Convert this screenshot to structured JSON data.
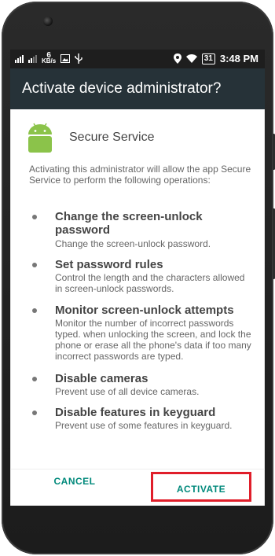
{
  "status_bar": {
    "network_speed_value": "6",
    "network_speed_unit": "KB/s",
    "time": "3:48",
    "time_suffix": "PM",
    "battery": "31"
  },
  "dialog": {
    "title": "Activate device administrator?",
    "app_name": "Secure Service",
    "intro": "Activating this administrator will allow the app Secure Service to perform the following operations:",
    "permissions": [
      {
        "title": "Change the screen-unlock password",
        "description": "Change the screen-unlock password."
      },
      {
        "title": "Set password rules",
        "description": "Control the length and the characters allowed in screen-unlock passwords."
      },
      {
        "title": "Monitor screen-unlock attempts",
        "description": "Monitor the number of incorrect passwords typed. when unlocking the screen, and lock the phone or erase all the phone's data if too many incorrect passwords are typed."
      },
      {
        "title": "Disable cameras",
        "description": "Prevent use of all device cameras."
      },
      {
        "title": "Disable features in keyguard",
        "description": "Prevent use of some features in keyguard."
      }
    ],
    "cancel_label": "CANCEL",
    "activate_label": "ACTIVATE"
  },
  "colors": {
    "title_bar": "#263238",
    "status_bar": "#1e1e1e",
    "accent": "#00897b",
    "highlight": "#e01e2a",
    "android_green": "#8bc34a"
  }
}
